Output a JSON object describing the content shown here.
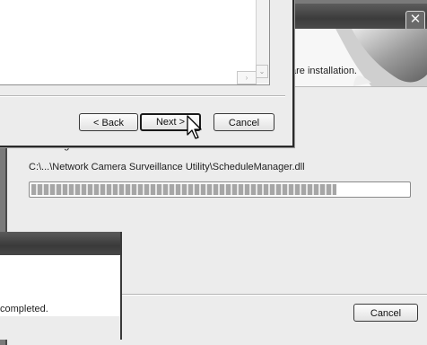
{
  "background_installer": {
    "close_glyph": "✕",
    "header_subtitle_fragment": "are installation.",
    "status_label": "Installing",
    "current_file": "C:\\...\\Network Camera Surveillance Utility\\ScheduleManager.dll",
    "progress_fraction": 0.81,
    "cancel_label": "Cancel"
  },
  "wizard_dialog": {
    "back_label": "< Back",
    "next_label": "Next >",
    "cancel_label": "Cancel",
    "scroll_down_glyph": "⌄",
    "scroll_right_glyph": "›"
  },
  "completion_dialog": {
    "message_fragment": "completed."
  },
  "icons": {
    "close": "close-icon",
    "cursor": "mouse-pointer-icon"
  }
}
